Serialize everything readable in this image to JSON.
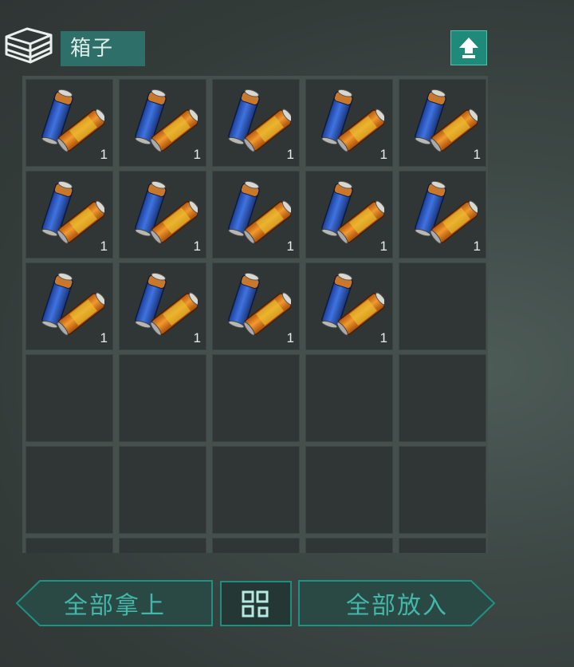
{
  "container": {
    "title": "箱子",
    "icon": "stacked-box-icon",
    "up_button_icon": "upload-arrow-icon"
  },
  "inventory": {
    "columns": 5,
    "slots": [
      {
        "item": "battery",
        "qty": "1"
      },
      {
        "item": "battery",
        "qty": "1"
      },
      {
        "item": "battery",
        "qty": "1"
      },
      {
        "item": "battery",
        "qty": "1"
      },
      {
        "item": "battery",
        "qty": "1"
      },
      {
        "item": "battery",
        "qty": "1"
      },
      {
        "item": "battery",
        "qty": "1"
      },
      {
        "item": "battery",
        "qty": "1"
      },
      {
        "item": "battery",
        "qty": "1"
      },
      {
        "item": "battery",
        "qty": "1"
      },
      {
        "item": "battery",
        "qty": "1"
      },
      {
        "item": "battery",
        "qty": "1"
      },
      {
        "item": "battery",
        "qty": "1"
      },
      {
        "item": "battery",
        "qty": "1"
      },
      {
        "item": null,
        "qty": ""
      },
      {
        "item": null,
        "qty": ""
      },
      {
        "item": null,
        "qty": ""
      },
      {
        "item": null,
        "qty": ""
      },
      {
        "item": null,
        "qty": ""
      },
      {
        "item": null,
        "qty": ""
      },
      {
        "item": null,
        "qty": ""
      },
      {
        "item": null,
        "qty": ""
      },
      {
        "item": null,
        "qty": ""
      },
      {
        "item": null,
        "qty": ""
      },
      {
        "item": null,
        "qty": ""
      },
      {
        "item": null,
        "qty": ""
      },
      {
        "item": null,
        "qty": ""
      },
      {
        "item": null,
        "qty": ""
      },
      {
        "item": null,
        "qty": ""
      },
      {
        "item": null,
        "qty": ""
      }
    ]
  },
  "actions": {
    "take_all_label": "全部拿上",
    "put_all_label": "全部放入",
    "sort_icon": "grid-sort-icon"
  },
  "colors": {
    "accent": "#1f8a7a",
    "accent_text": "#43b7aa",
    "slot_bg": "#303536"
  }
}
